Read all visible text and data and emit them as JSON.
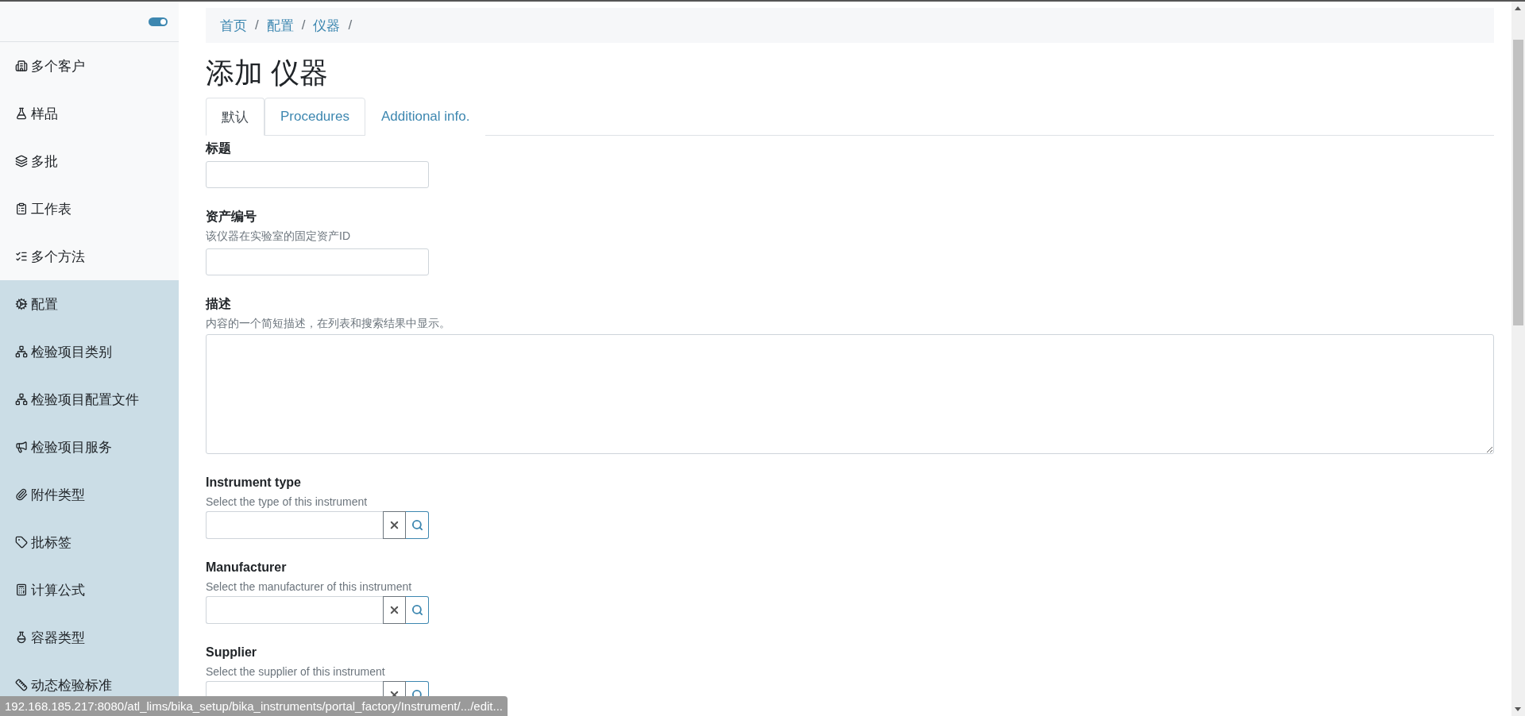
{
  "sidebar": {
    "toggle": {
      "on": true
    },
    "items": [
      {
        "label": "多个客户",
        "highlighted": false
      },
      {
        "label": "样品",
        "highlighted": false
      },
      {
        "label": "多批",
        "highlighted": false
      },
      {
        "label": "工作表",
        "highlighted": false
      },
      {
        "label": "多个方法",
        "highlighted": false
      },
      {
        "label": "配置",
        "highlighted": true
      },
      {
        "label": "检验项目类别",
        "highlighted": true
      },
      {
        "label": "检验项目配置文件",
        "highlighted": true
      },
      {
        "label": "检验项目服务",
        "highlighted": true
      },
      {
        "label": "附件类型",
        "highlighted": true
      },
      {
        "label": "批标签",
        "highlighted": true
      },
      {
        "label": "计算公式",
        "highlighted": true
      },
      {
        "label": "容器类型",
        "highlighted": true
      },
      {
        "label": "动态检验标准",
        "highlighted": true
      }
    ]
  },
  "breadcrumb": [
    {
      "label": "首页",
      "separator": "/"
    },
    {
      "label": "配置",
      "separator": "/"
    },
    {
      "label": "仪器",
      "separator": "/"
    }
  ],
  "title": "添加 仪器",
  "tabs": [
    {
      "label": "默认",
      "selected": true
    },
    {
      "label": "Procedures",
      "selected": false
    },
    {
      "label": "Additional info.",
      "selected": false
    }
  ],
  "fields": [
    {
      "kind": "text",
      "label": "标题"
    },
    {
      "kind": "text",
      "label": "资产编号",
      "help": "该仪器在实验室的固定资产ID"
    },
    {
      "kind": "textarea",
      "label": "描述",
      "help": "内容的一个简短描述，在列表和搜索结果中显示。"
    },
    {
      "kind": "reference",
      "label": "Instrument type",
      "help": "Select the type of this instrument"
    },
    {
      "kind": "reference",
      "label": "Manufacturer",
      "help": "Select the manufacturer of this instrument"
    },
    {
      "kind": "reference",
      "label": "Supplier",
      "help": "Select the supplier of this instrument"
    }
  ],
  "status_bar": {
    "url": "192.168.185.217:8080/atl_lims/bika_setup/bika_instruments/portal_factory/Instrument/.../edit..."
  }
}
